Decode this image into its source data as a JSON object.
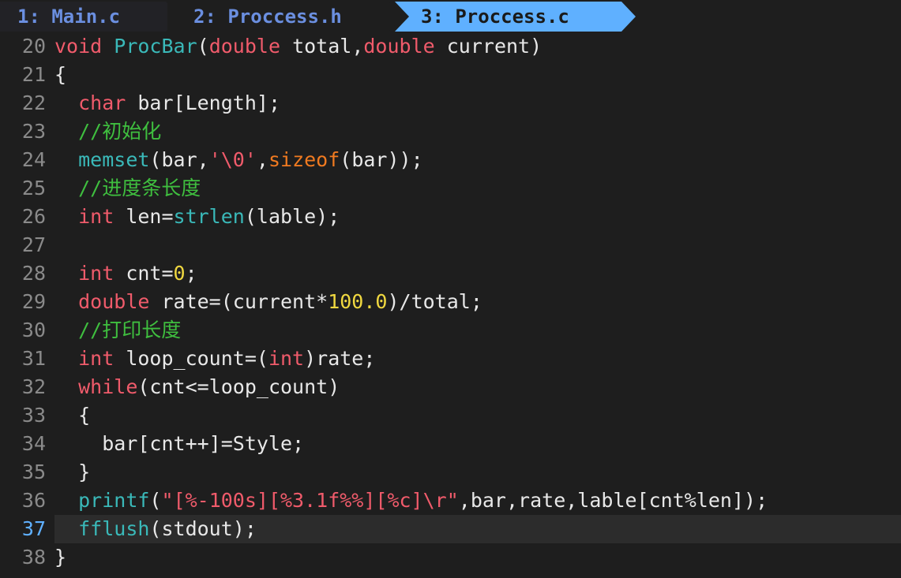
{
  "tabs": [
    {
      "label": "1: Main.c",
      "active": false
    },
    {
      "label": "2: Proccess.h",
      "active": false
    },
    {
      "label": "3: Proccess.c",
      "active": true
    }
  ],
  "colors": {
    "background": "#1e1e1e",
    "tab_active_bg": "#5fb0ff",
    "tab_inactive_fg": "#6b8fe0",
    "keyword": "#f05b6b",
    "function": "#3ab9b9",
    "operator_keyword": "#f07a20",
    "number": "#f0d840",
    "comment": "#3fbf3f",
    "cursorline_number": "#5fb0ff"
  },
  "editor": {
    "cursor_line": 37,
    "lines": [
      {
        "number": "20",
        "tokens": [
          {
            "t": "void",
            "c": "kw"
          },
          {
            "t": " ",
            "c": "plain"
          },
          {
            "t": "ProcBar",
            "c": "fn"
          },
          {
            "t": "(",
            "c": "plain"
          },
          {
            "t": "double",
            "c": "kw"
          },
          {
            "t": " total,",
            "c": "plain"
          },
          {
            "t": "double",
            "c": "kw"
          },
          {
            "t": " current)",
            "c": "plain"
          }
        ]
      },
      {
        "number": "21",
        "tokens": [
          {
            "t": "{",
            "c": "plain"
          }
        ]
      },
      {
        "number": "22",
        "tokens": [
          {
            "t": "  ",
            "c": "plain"
          },
          {
            "t": "char",
            "c": "kw"
          },
          {
            "t": " bar[Length];",
            "c": "plain"
          }
        ]
      },
      {
        "number": "23",
        "tokens": [
          {
            "t": "  ",
            "c": "plain"
          },
          {
            "t": "//初始化",
            "c": "cm"
          }
        ]
      },
      {
        "number": "24",
        "tokens": [
          {
            "t": "  ",
            "c": "plain"
          },
          {
            "t": "memset",
            "c": "fn"
          },
          {
            "t": "(bar,",
            "c": "plain"
          },
          {
            "t": "'\\0'",
            "c": "str"
          },
          {
            "t": ",",
            "c": "plain"
          },
          {
            "t": "sizeof",
            "c": "op"
          },
          {
            "t": "(bar));",
            "c": "plain"
          }
        ]
      },
      {
        "number": "25",
        "tokens": [
          {
            "t": "  ",
            "c": "plain"
          },
          {
            "t": "//进度条长度",
            "c": "cm"
          }
        ]
      },
      {
        "number": "26",
        "tokens": [
          {
            "t": "  ",
            "c": "plain"
          },
          {
            "t": "int",
            "c": "kw"
          },
          {
            "t": " len=",
            "c": "plain"
          },
          {
            "t": "strlen",
            "c": "fn"
          },
          {
            "t": "(lable);",
            "c": "plain"
          }
        ]
      },
      {
        "number": "27",
        "tokens": []
      },
      {
        "number": "28",
        "tokens": [
          {
            "t": "  ",
            "c": "plain"
          },
          {
            "t": "int",
            "c": "kw"
          },
          {
            "t": " cnt=",
            "c": "plain"
          },
          {
            "t": "0",
            "c": "num"
          },
          {
            "t": ";",
            "c": "plain"
          }
        ]
      },
      {
        "number": "29",
        "tokens": [
          {
            "t": "  ",
            "c": "plain"
          },
          {
            "t": "double",
            "c": "kw"
          },
          {
            "t": " rate=(current*",
            "c": "plain"
          },
          {
            "t": "100.0",
            "c": "num"
          },
          {
            "t": ")/total;",
            "c": "plain"
          }
        ]
      },
      {
        "number": "30",
        "tokens": [
          {
            "t": "  ",
            "c": "plain"
          },
          {
            "t": "//打印长度",
            "c": "cm"
          }
        ]
      },
      {
        "number": "31",
        "tokens": [
          {
            "t": "  ",
            "c": "plain"
          },
          {
            "t": "int",
            "c": "kw"
          },
          {
            "t": " loop_count=(",
            "c": "plain"
          },
          {
            "t": "int",
            "c": "kw"
          },
          {
            "t": ")rate;",
            "c": "plain"
          }
        ]
      },
      {
        "number": "32",
        "tokens": [
          {
            "t": "  ",
            "c": "plain"
          },
          {
            "t": "while",
            "c": "kw"
          },
          {
            "t": "(cnt<=loop_count)",
            "c": "plain"
          }
        ]
      },
      {
        "number": "33",
        "tokens": [
          {
            "t": "  {",
            "c": "plain"
          }
        ]
      },
      {
        "number": "34",
        "tokens": [
          {
            "t": "    bar[cnt++]=Style;",
            "c": "plain"
          }
        ]
      },
      {
        "number": "35",
        "tokens": [
          {
            "t": "  }",
            "c": "plain"
          }
        ]
      },
      {
        "number": "36",
        "tokens": [
          {
            "t": "  ",
            "c": "plain"
          },
          {
            "t": "printf",
            "c": "fn"
          },
          {
            "t": "(",
            "c": "plain"
          },
          {
            "t": "\"[%-100s][%3.1f%%][%c]\\r\"",
            "c": "str"
          },
          {
            "t": ",bar,rate,lable[cnt%len]);",
            "c": "plain"
          }
        ]
      },
      {
        "number": "37",
        "tokens": [
          {
            "t": "  ",
            "c": "plain"
          },
          {
            "t": "fflush",
            "c": "fn"
          },
          {
            "t": "(stdout);",
            "c": "plain"
          }
        ]
      },
      {
        "number": "38",
        "tokens": [
          {
            "t": "}",
            "c": "plain"
          }
        ]
      }
    ]
  }
}
